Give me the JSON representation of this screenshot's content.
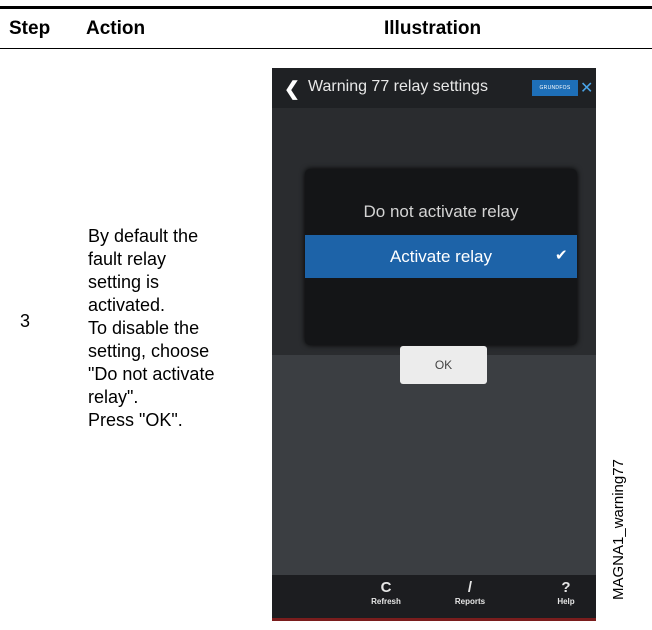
{
  "table": {
    "headers": {
      "step": "Step",
      "action": "Action",
      "illustration": "Illustration"
    },
    "row": {
      "step": "3",
      "action_lines": [
        "By default the",
        "fault relay",
        "setting is",
        "activated.",
        "To disable the",
        "setting, choose",
        "\"Do not activate",
        "relay\".",
        "Press \"OK\"."
      ]
    }
  },
  "phone": {
    "title": "Warning 77 relay settings",
    "logo_text": "GRUNDFOS",
    "icons": {
      "back": "chevron-left-icon",
      "close": "close-icon",
      "check": "check-icon"
    },
    "options": [
      "Do not activate relay",
      "Activate relay"
    ],
    "selected_option": "Activate relay",
    "ok_label": "OK",
    "toolbar": [
      {
        "icon": "refresh-icon",
        "label": "Refresh"
      },
      {
        "icon": "reports-icon",
        "label": "Reports"
      },
      {
        "icon": "help-icon",
        "label": "Help"
      }
    ],
    "colors": {
      "accent": "#1d63a8",
      "title_bar": "#1f2124",
      "screen_bg": "#3b3e42"
    }
  },
  "figure_id": "MAGNA1_warning77"
}
